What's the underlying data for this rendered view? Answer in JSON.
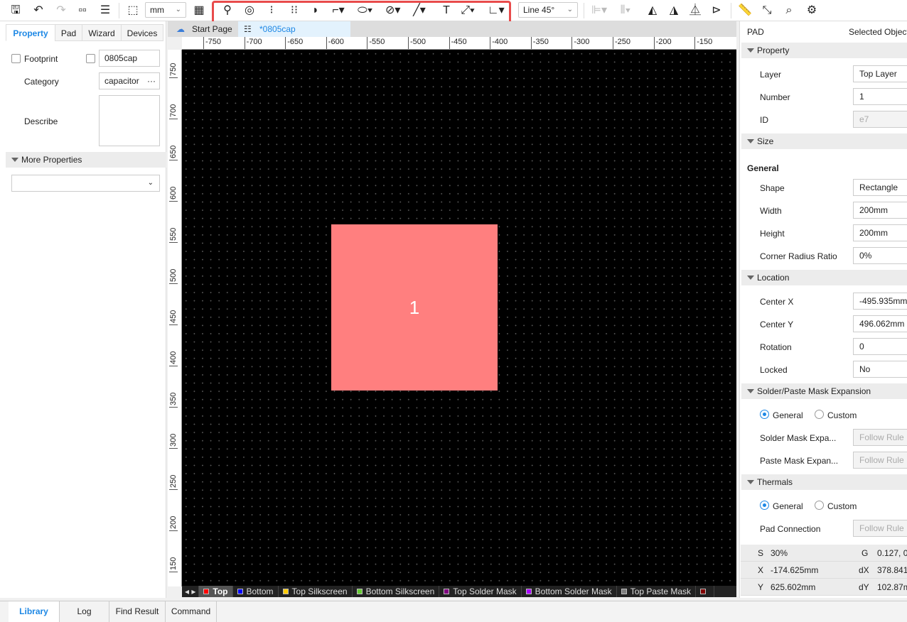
{
  "toolbar": {
    "unit": "mm",
    "route_mode": "Line 45°",
    "icons": [
      "save-icon",
      "undo-icon",
      "redo-icon",
      "grid-layout-icon",
      "search-list-icon",
      "zoom-area-icon",
      "grid-icon",
      "pin-icon",
      "via-icon",
      "pad-column-icon",
      "pad-array-icon",
      "shape-icon",
      "rectangle-icon",
      "ellipse-icon",
      "circle-slash-icon",
      "line-icon",
      "text-icon",
      "dimension-icon",
      "angle-icon",
      "align-left-icon",
      "distribute-icon",
      "rotate-left-icon",
      "rotate-right-icon",
      "flip-horizontal-icon",
      "flip-vertical-icon",
      "ruler-icon",
      "measure-icon",
      "inspect-icon",
      "settings-icon"
    ]
  },
  "left_panel": {
    "tabs": [
      "Property",
      "Pad",
      "Wizard",
      "Devices"
    ],
    "active_tab": "Property",
    "footprint_label": "Footprint",
    "footprint_value": "0805cap",
    "category_label": "Category",
    "category_value": "capacitor",
    "describe_label": "Describe",
    "describe_value": "",
    "more_properties": "More Properties",
    "more_select": ""
  },
  "doc_tabs": [
    {
      "label": "Start Page"
    },
    {
      "label": "*0805cap",
      "active": true
    }
  ],
  "ruler": {
    "top": [
      "-750",
      "-700",
      "-650",
      "-600",
      "-550",
      "-500",
      "-450",
      "-400",
      "-350",
      "-300",
      "-250",
      "-200",
      "-150"
    ],
    "left": [
      "750",
      "700",
      "650",
      "600",
      "550",
      "500",
      "450",
      "400",
      "350",
      "300",
      "250",
      "200",
      "150"
    ]
  },
  "canvas": {
    "pad_number": "1",
    "pad_color": "#ff7f7f",
    "background": "#000000"
  },
  "layers": [
    {
      "name": "Top",
      "color": "#ff0000",
      "active": true
    },
    {
      "name": "Bottom",
      "color": "#0000ff"
    },
    {
      "name": "Top Silkscreen",
      "color": "#ffcc00"
    },
    {
      "name": "Bottom Silkscreen",
      "color": "#66cc33"
    },
    {
      "name": "Top Solder Mask",
      "color": "#800080"
    },
    {
      "name": "Bottom Solder Mask",
      "color": "#aa00ff"
    },
    {
      "name": "Top Paste Mask",
      "color": "#808080"
    },
    {
      "name": "",
      "color": "#800000"
    }
  ],
  "bottom_tabs": [
    "Library",
    "Log",
    "Find Result",
    "Command"
  ],
  "right_panel": {
    "header_left": "PAD",
    "header_right": "Selected Objects",
    "property": "Property",
    "layer_label": "Layer",
    "layer": "Top Layer",
    "number_label": "Number",
    "number": "1",
    "id_label": "ID",
    "id": "e7",
    "size": "Size",
    "general_heading": "General",
    "shape_label": "Shape",
    "shape": "Rectangle",
    "width_label": "Width",
    "width": "200mm",
    "height_label": "Height",
    "height": "200mm",
    "corner_label": "Corner Radius Ratio",
    "corner": "0%",
    "location": "Location",
    "cx_label": "Center X",
    "cx": "-495.935mm",
    "cy_label": "Center Y",
    "cy": "496.062mm",
    "rot_label": "Rotation",
    "rot": "0",
    "locked_label": "Locked",
    "locked": "No",
    "mask": "Solder/Paste Mask Expansion",
    "general": "General",
    "custom": "Custom",
    "solder_label": "Solder Mask Expa...",
    "solder": "Follow Rule",
    "paste_label": "Paste Mask Expan...",
    "paste": "Follow Rule",
    "thermals": "Thermals",
    "padconn_label": "Pad Connection",
    "padconn": "Follow Rule"
  },
  "status": {
    "s_label": "S",
    "s": "30%",
    "g_label": "G",
    "g": "0.127, 0",
    "x_label": "X",
    "x": "-174.625mm",
    "dx_label": "dX",
    "dx": "378.841",
    "y_label": "Y",
    "y": "625.602mm",
    "dy_label": "dY",
    "dy": "102.87m"
  }
}
